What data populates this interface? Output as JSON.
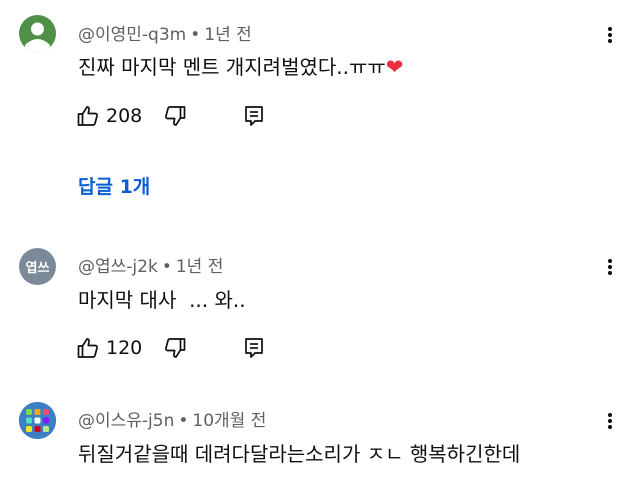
{
  "comments": [
    {
      "author": "@이영민-q3m",
      "time": "1년 전",
      "text": "진짜 마지막 멘트 개지려벌였다..ㅠㅠ",
      "emoji": "❤️",
      "likes": "208",
      "avatar_icon": "default-person-avatar"
    },
    {
      "author": "@엽쓰-j2k",
      "time": "1년 전",
      "text": "마지막 대사  ... 와..",
      "likes": "120",
      "avatar_text": "엽쓰",
      "avatar_color": "#7b8a99"
    },
    {
      "author": "@이스유-j5n",
      "time": "10개월 전",
      "text": "뒤질거같을때 데려다달라는소리가 ㅈㄴ 행복하긴한데",
      "avatar_icon": "app-grid-avatar"
    }
  ],
  "replies_label": "답글 1개",
  "colors": {
    "link": "#065fd4",
    "meta": "#606060",
    "heart": "#e8303f"
  }
}
